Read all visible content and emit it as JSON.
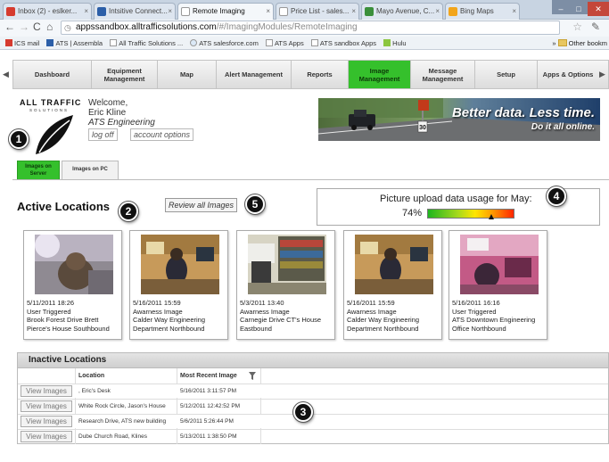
{
  "browser": {
    "tabs": [
      {
        "label": "Inbox (2) - eslker...",
        "active": false,
        "favicon_color": "#d63b2f"
      },
      {
        "label": "Intsitive Connect...",
        "active": false,
        "favicon_color": "#2c5fa8"
      },
      {
        "label": "Remote Imaging",
        "active": true,
        "favicon_color": "#ffffff"
      },
      {
        "label": "Price List - sales...",
        "active": false,
        "favicon_color": "#ffffff"
      },
      {
        "label": "Mayo Avenue, C...",
        "active": false,
        "favicon_color": "#3b8f3b"
      },
      {
        "label": "Bing Maps",
        "active": false,
        "favicon_color": "#f2a51b"
      }
    ],
    "url_host": "appssandbox.alltrafficsolutions.com",
    "url_path": "/#/ImagingModules/RemoteImaging",
    "bookmarks": [
      "ICS mail",
      "ATS | Assembla",
      "All Traffic Solutions ...",
      "ATS salesforce.com",
      "ATS Apps",
      "ATS sandbox Apps",
      "Hulu"
    ],
    "other_bookmarks": "Other bookm"
  },
  "nav": {
    "items": [
      {
        "label": "Dashboard",
        "active": false
      },
      {
        "label": "Equipment Management",
        "active": false
      },
      {
        "label": "Map",
        "active": false
      },
      {
        "label": "Alert Management",
        "active": false
      },
      {
        "label": "Reports",
        "active": false
      },
      {
        "label": "Image Management",
        "active": true
      },
      {
        "label": "Message Management",
        "active": false
      },
      {
        "label": "Setup",
        "active": false
      },
      {
        "label": "Apps & Options",
        "active": false
      }
    ]
  },
  "header": {
    "logo_text": "ALL TRAFFIC",
    "logo_sub": "SOLUTIONS",
    "welcome": "Welcome,",
    "user_name": "Eric Kline",
    "company": "ATS Engineering",
    "logoff_label": "log off",
    "account_label": "account options",
    "banner_line1": "Better data. Less time.",
    "banner_line2": "Do it all online.",
    "banner_speed_sign": "30"
  },
  "subtabs": {
    "server": "Images on Server",
    "pc": "Images on PC"
  },
  "active": {
    "title": "Active Locations",
    "review_label": "Review all Images",
    "usage_title": "Picture upload data usage for May:",
    "usage_pct_label": "74%",
    "usage_fraction": 0.74,
    "cards": [
      {
        "date": "5/11/2011 18:26",
        "type": "User Triggered",
        "line1": "Brook Forest Drive Brett",
        "line2": "Pierce's House Southbound",
        "scene": "dog"
      },
      {
        "date": "5/16/2011 15:59",
        "type": "Awarness Image",
        "line1": "Calder Way Engineering",
        "line2": "Department Northbound",
        "scene": "office"
      },
      {
        "date": "5/3/2011 13:40",
        "type": "Awarness Image",
        "line1": "Carnegie Drive CT's House",
        "line2": "Eastbound",
        "scene": "shelf"
      },
      {
        "date": "5/16/2011 15:59",
        "type": "Awarness Image",
        "line1": "Calder Way Engineering",
        "line2": "Department Northbound",
        "scene": "office"
      },
      {
        "date": "5/16/2011 16:16",
        "type": "User Triggered",
        "line1": "ATS Downtown Engineering",
        "line2": "Office Northbound",
        "scene": "pink"
      }
    ]
  },
  "inactive": {
    "title": "Inactive Locations",
    "col_location": "Location",
    "col_recent": "Most Recent Image",
    "view_label": "View Images",
    "rows": [
      {
        "location": ", Eric's Desk",
        "recent": "5/16/2011 3:11:57 PM"
      },
      {
        "location": "White Rock Circle, Jason's House",
        "recent": "5/12/2011 12:42:52 PM"
      },
      {
        "location": "Research Drive, ATS new building",
        "recent": "5/6/2011 5:26:44 PM"
      },
      {
        "location": "Dube Church Road, Klines",
        "recent": "5/13/2011 1:38:50 PM"
      }
    ]
  },
  "callouts": [
    "1",
    "2",
    "3",
    "4",
    "5"
  ]
}
